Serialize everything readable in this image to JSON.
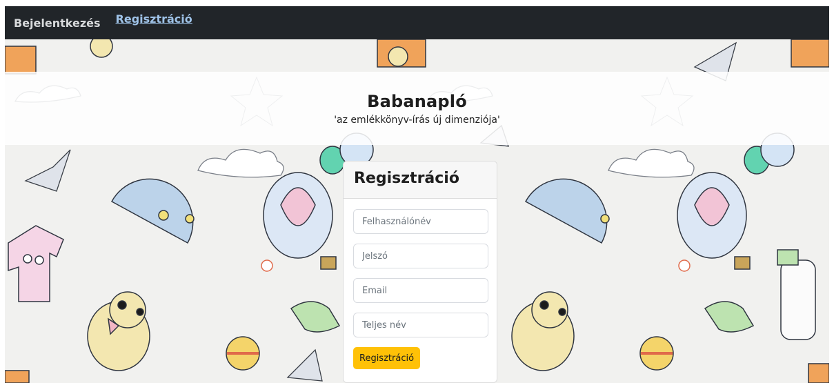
{
  "nav": {
    "items": [
      {
        "label": "Bejelentkezés",
        "active": false
      },
      {
        "label": "Regisztráció",
        "active": true
      }
    ]
  },
  "hero": {
    "title": "Babanapló",
    "subtitle": "'az emlékkönyv-írás új dimenziója'"
  },
  "form": {
    "title": "Regisztráció",
    "fields": {
      "username": {
        "placeholder": "Felhasználónév",
        "value": ""
      },
      "password": {
        "placeholder": "Jelszó",
        "value": ""
      },
      "email": {
        "placeholder": "Email",
        "value": ""
      },
      "fullname": {
        "placeholder": "Teljes név",
        "value": ""
      }
    },
    "submit_label": "Regisztráció"
  },
  "colors": {
    "navbar": "#212529",
    "accent": "#ffc107",
    "wallpaper": "#f1f1ef"
  }
}
